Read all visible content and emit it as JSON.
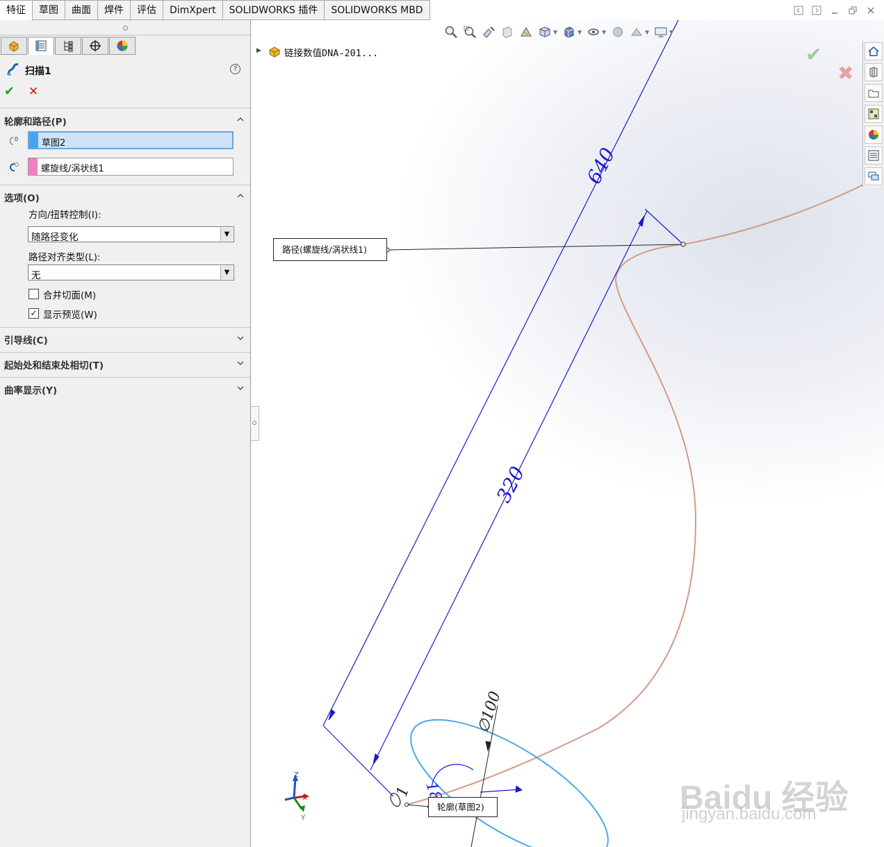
{
  "tabs": [
    "特征",
    "草图",
    "曲面",
    "焊件",
    "评估",
    "DimXpert",
    "SOLIDWORKS 插件",
    "SOLIDWORKS MBD"
  ],
  "active_tab": 0,
  "property_manager": {
    "title": "扫描1",
    "help_glyph": "?",
    "ok_glyph": "✔",
    "cancel_glyph": "✕",
    "profile_path": {
      "header": "轮廓和路径(P)",
      "profile_value": "草图2",
      "profile_color": "#4aa3f0",
      "path_value": "螺旋线/涡状线1",
      "path_color": "#f080c0"
    },
    "options": {
      "header": "选项(O)",
      "orientation_label": "方向/扭转控制(I):",
      "orientation_value": "随路径变化",
      "path_align_label": "路径对齐类型(L):",
      "path_align_value": "无",
      "merge_faces_label": "合并切面(M)",
      "merge_faces_checked": false,
      "show_preview_label": "显示预览(W)",
      "show_preview_checked": true
    },
    "collapsed_groups": [
      "引导线(C)",
      "起始处和结束处相切(T)",
      "曲率显示(Y)"
    ]
  },
  "viewport": {
    "tree_label": "链接数值DNA-201...",
    "dimensions": {
      "height": "640",
      "pitch": "320",
      "diameter": "∅100",
      "angle": "18",
      "small": "1"
    },
    "callout_path": "路径(螺旋线/涡状线1)",
    "callout_profile": "轮廓(草图2)",
    "triad": {
      "x": "X",
      "y": "Y",
      "z": "Z"
    },
    "watermark_logo": "Baidu 经验",
    "watermark_url": "jingyan.baidu.com"
  },
  "colors": {
    "dimension": "#1a1acc",
    "helix": "#d49a86",
    "profile_circle": "#4aa8e8",
    "accent_blue": "#4aa3f0"
  },
  "icons": [
    "feature-manager-icon",
    "property-manager-icon",
    "configuration-manager-icon",
    "dimxpert-manager-icon",
    "display-manager-icon",
    "sweep-icon",
    "zoom-to-fit-icon",
    "zoom-area-icon",
    "previous-view-icon",
    "section-view-icon",
    "view-orientation-icon",
    "display-style-icon",
    "hide-show-icon",
    "appearance-icon",
    "scene-icon",
    "display-settings-icon",
    "home-icon",
    "design-library-icon",
    "file-explorer-icon",
    "view-palette-icon",
    "appearances-icon",
    "custom-properties-icon",
    "forum-icon"
  ]
}
